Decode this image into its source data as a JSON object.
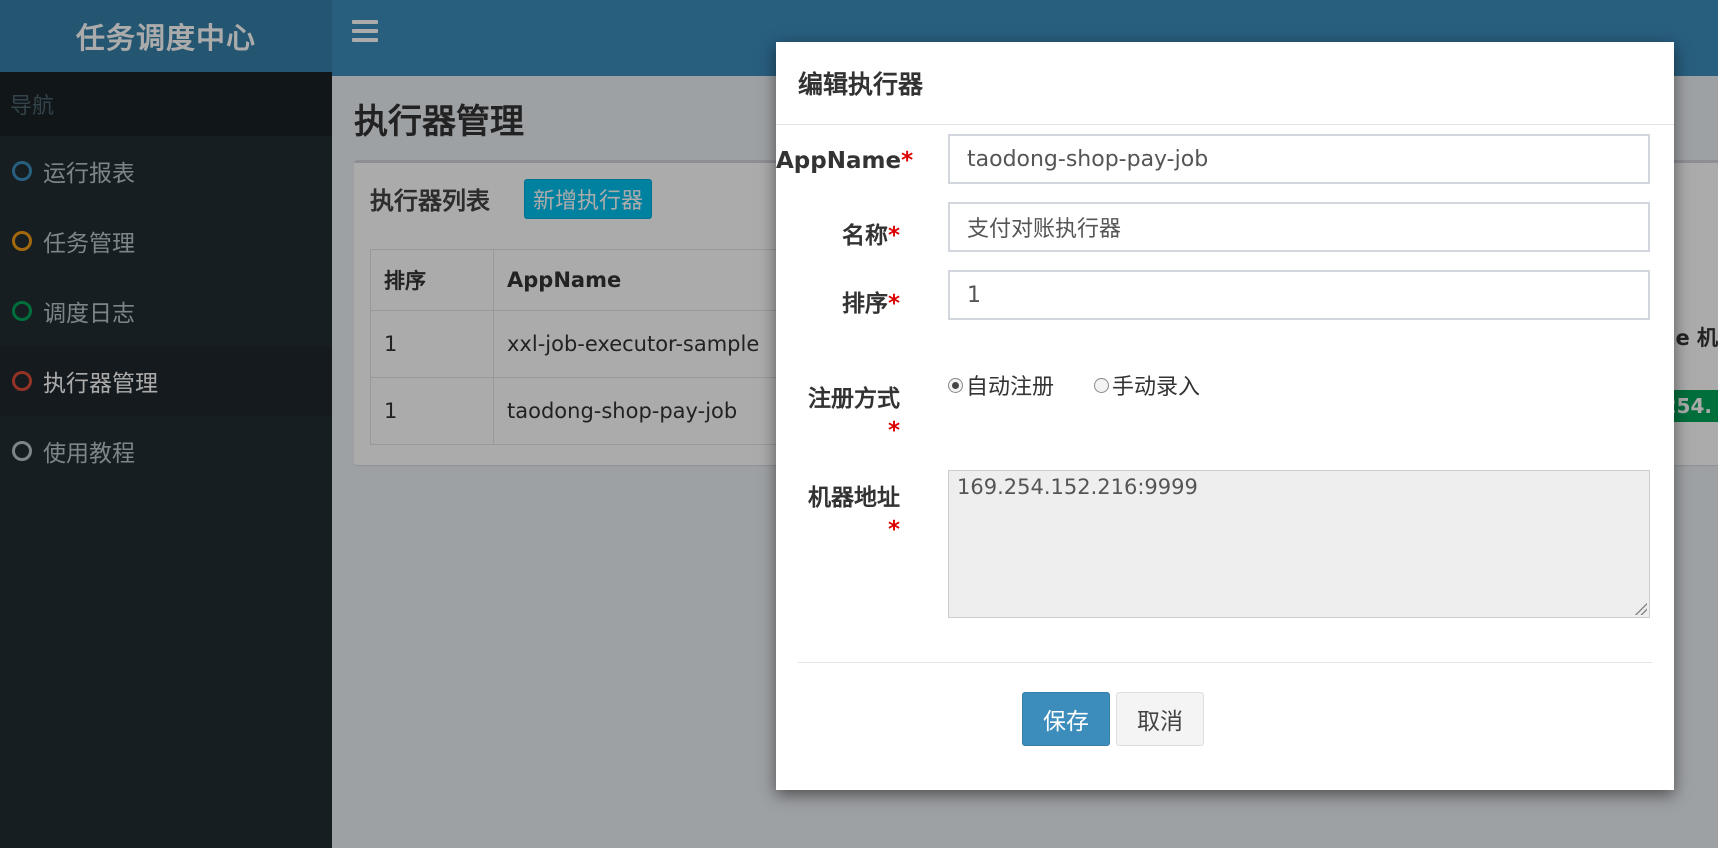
{
  "app": {
    "title": "任务调度中心"
  },
  "sidebar": {
    "header": "导航",
    "items": [
      {
        "label": "运行报表",
        "color": "#3c8dbc",
        "active": false
      },
      {
        "label": "任务管理",
        "color": "#f39c12",
        "active": false
      },
      {
        "label": "调度日志",
        "color": "#00a65a",
        "active": false
      },
      {
        "label": "执行器管理",
        "color": "#dd4b39",
        "active": true
      },
      {
        "label": "使用教程",
        "color": "#b8c7ce",
        "active": false
      }
    ]
  },
  "header": {
    "menu_icon": "hamburger-icon"
  },
  "main": {
    "page_title": "执行器管理",
    "box_title": "执行器列表",
    "add_button": "新增执行器",
    "table": {
      "columns": [
        "排序",
        "AppName"
      ],
      "cut_column": "e 机",
      "rows": [
        {
          "order": "1",
          "appname": "xxl-job-executor-sample"
        },
        {
          "order": "1",
          "appname": "taodong-shop-pay-job"
        }
      ],
      "badge": "254."
    }
  },
  "modal": {
    "title": "编辑执行器",
    "fields": {
      "appname": {
        "label": "AppName",
        "required": "*",
        "value": "taodong-shop-pay-job"
      },
      "name": {
        "label": "名称",
        "required": "*",
        "value": "支付对账执行器"
      },
      "order": {
        "label": "排序",
        "required": "*",
        "value": "1"
      },
      "register": {
        "label": "注册方式",
        "required": "*",
        "options": [
          "自动注册",
          "手动录入"
        ],
        "selected": "自动注册"
      },
      "address": {
        "label": "机器地址",
        "required": "*",
        "value": "169.254.152.216:9999"
      }
    },
    "save_label": "保存",
    "cancel_label": "取消"
  }
}
